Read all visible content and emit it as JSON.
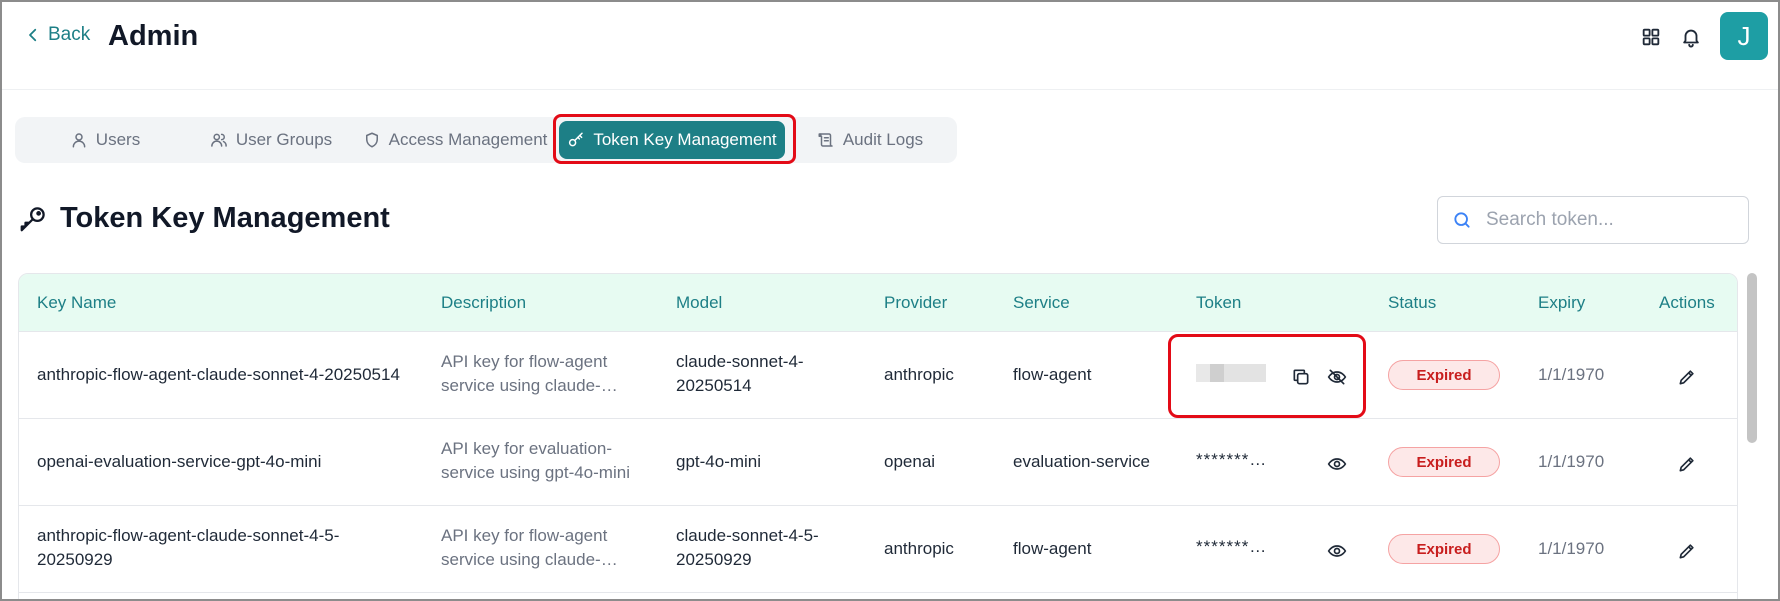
{
  "header": {
    "back_label": "Back",
    "title": "Admin",
    "apps_icon": "grid-icon",
    "bell_icon": "bell-icon",
    "avatar_initial": "J"
  },
  "tabs": [
    {
      "label": "Users",
      "icon": "user-icon",
      "active": false
    },
    {
      "label": "User Groups",
      "icon": "users-icon",
      "active": false
    },
    {
      "label": "Access Management",
      "icon": "shield-icon",
      "active": false
    },
    {
      "label": "Token Key Management",
      "icon": "key-icon",
      "active": true
    },
    {
      "label": "Audit Logs",
      "icon": "scroll-icon",
      "active": false
    }
  ],
  "section": {
    "title": "Token Key Management",
    "icon": "key-icon"
  },
  "search": {
    "placeholder": "Search token...",
    "value": ""
  },
  "table": {
    "columns": [
      "Key Name",
      "Description",
      "Model",
      "Provider",
      "Service",
      "Token",
      "Status",
      "Expiry",
      "Actions"
    ],
    "rows": [
      {
        "key_name": "anthropic-flow-agent-claude-sonnet-4-20250514",
        "desc_line1": "API key for flow-agent",
        "desc_line2": "service using claude-…",
        "model_line1": "claude-sonnet-4-",
        "model_line2": "20250514",
        "provider": "anthropic",
        "service": "flow-agent",
        "token": "",
        "token_revealed": true,
        "status": "Expired",
        "expiry": "1/1/1970"
      },
      {
        "key_name": "openai-evaluation-service-gpt-4o-mini",
        "desc_line1": "API key for evaluation-",
        "desc_line2": "service using gpt-4o-mini",
        "model_line1": "gpt-4o-mini",
        "model_line2": "",
        "provider": "openai",
        "service": "evaluation-service",
        "token": "*******…",
        "token_revealed": false,
        "status": "Expired",
        "expiry": "1/1/1970"
      },
      {
        "key_name_line1": "anthropic-flow-agent-claude-sonnet-4-5-",
        "key_name_line2": "20250929",
        "desc_line1": "API key for flow-agent",
        "desc_line2": "service using claude-…",
        "model_line1": "claude-sonnet-4-5-",
        "model_line2": "20250929",
        "provider": "anthropic",
        "service": "flow-agent",
        "token": "*******…",
        "token_revealed": false,
        "status": "Expired",
        "expiry": "1/1/1970"
      }
    ]
  },
  "colors": {
    "accent": "#1d7f86",
    "header_bg": "#e7fbf2",
    "expired_text": "#c81e1e",
    "expired_bg": "#fde8e8",
    "highlight": "#e30b17"
  }
}
